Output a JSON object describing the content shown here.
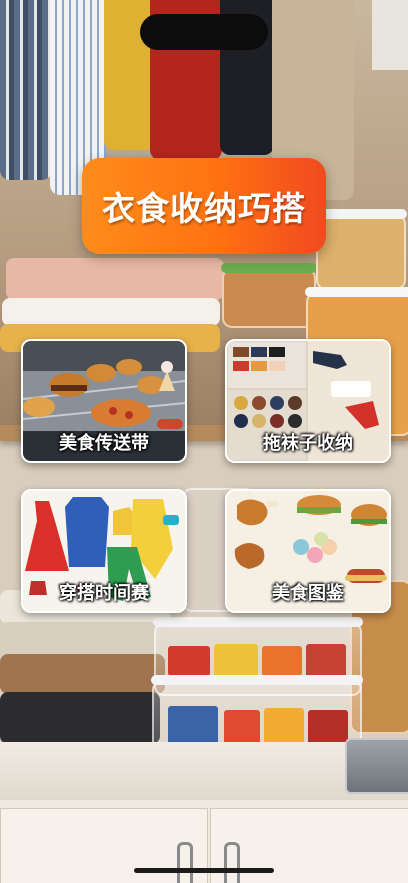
{
  "banner": {
    "title": "衣食收纳巧搭"
  },
  "tiles": [
    {
      "label": "美食传送带",
      "icon": "burger-conveyor-image"
    },
    {
      "label": "拖袜子收纳",
      "icon": "socks-organizer-image"
    },
    {
      "label": "穿搭时间赛",
      "icon": "clothes-outfit-image"
    },
    {
      "label": "美食图鉴",
      "icon": "food-collection-image"
    }
  ],
  "colors": {
    "banner_start": "#ff8c1a",
    "banner_end": "#f04a1f",
    "tile_border": "#ffffff"
  }
}
